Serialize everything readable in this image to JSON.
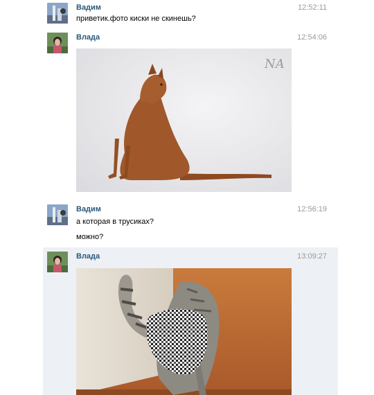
{
  "messages": [
    {
      "author": "Вадим",
      "time": "12:52:11",
      "texts": [
        "приветик.фото киски не скинешь?"
      ]
    },
    {
      "author": "Влада",
      "time": "12:54:06",
      "photo": {
        "subject": "abyssinian-cat-photo",
        "watermark": "NA"
      }
    },
    {
      "author": "Вадим",
      "time": "12:56:19",
      "texts": [
        "а которая в трусиках?",
        "можно?"
      ]
    },
    {
      "author": "Влада",
      "time": "13:09:27",
      "photo": {
        "subject": "cat-in-underwear-photo"
      }
    }
  ],
  "colors": {
    "author": "#2b587a",
    "time": "#999999",
    "highlight": "#edf1f5"
  }
}
